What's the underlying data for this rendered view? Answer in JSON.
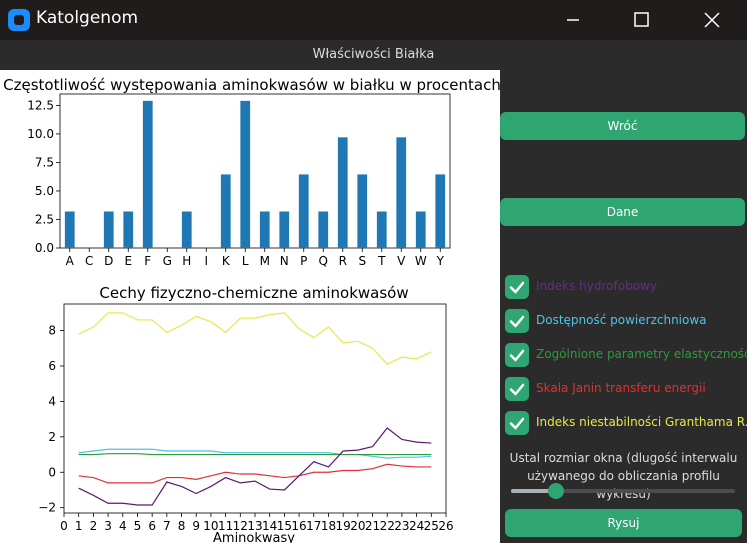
{
  "window": {
    "title": "Katolgenom"
  },
  "header": {
    "title": "Właściwości Białka"
  },
  "sidebar": {
    "back_label": "Wróć",
    "data_label": "Dane",
    "checkboxes": [
      {
        "label": "Indeks hydrofobowy",
        "color": "#6a2a8c",
        "checked": true
      },
      {
        "label": "Dostępność powierzchniowa",
        "color": "#4fc3e8",
        "checked": true
      },
      {
        "label": "Zogólnione parametry elastyczności",
        "color": "#2e9a3a",
        "checked": true
      },
      {
        "label": "Skala Janin transferu energii",
        "color": "#e03030",
        "checked": true
      },
      {
        "label": "Indeks niestabilności Granthama R.",
        "color": "#e6e84a",
        "checked": true
      }
    ],
    "slider": {
      "label": "Ustal rozmiar okna (dlugość interwalu używanego do obliczania profilu wykresu)",
      "value": 0.2
    },
    "draw_label": "Rysuj"
  },
  "chart_data": [
    {
      "type": "bar",
      "title": "Częstotliwość występowania aminokwasów w białku w procentach",
      "xlabel": "",
      "ylabel": "",
      "categories": [
        "A",
        "C",
        "D",
        "E",
        "F",
        "G",
        "H",
        "I",
        "K",
        "L",
        "M",
        "N",
        "P",
        "Q",
        "R",
        "S",
        "T",
        "V",
        "W",
        "Y"
      ],
      "values": [
        3.2,
        0,
        3.2,
        3.2,
        12.9,
        0,
        3.2,
        0,
        6.45,
        12.9,
        3.2,
        3.2,
        6.45,
        3.2,
        9.7,
        6.45,
        3.2,
        9.7,
        3.2,
        6.45
      ],
      "yticks": [
        "0.0",
        "2.5",
        "5.0",
        "7.5",
        "10.0",
        "12.5"
      ],
      "ylim": [
        0,
        13.5
      ],
      "color": "#1f77b4"
    },
    {
      "type": "line",
      "title": "Cechy fizyczno-chemiczne aminokwasów",
      "xlabel": "Aminokwasy",
      "ylabel": "",
      "xlim": [
        0,
        26
      ],
      "ylim": [
        -2.3,
        9.5
      ],
      "xticks": [
        "0",
        "1",
        "2",
        "3",
        "4",
        "5",
        "6",
        "7",
        "8",
        "9",
        "10",
        "11",
        "12",
        "13",
        "14",
        "15",
        "16",
        "17",
        "18",
        "19",
        "20",
        "21",
        "22",
        "23",
        "24",
        "25",
        "26"
      ],
      "yticks": [
        "−2",
        "0",
        "2",
        "4",
        "6",
        "8"
      ],
      "x": [
        1,
        2,
        3,
        4,
        5,
        6,
        7,
        8,
        9,
        10,
        11,
        12,
        13,
        14,
        15,
        16,
        17,
        18,
        19,
        20,
        21,
        22,
        23,
        24,
        25
      ],
      "series": [
        {
          "color": "#e6e84a",
          "values": [
            7.8,
            8.2,
            9.0,
            9.0,
            8.6,
            8.6,
            7.9,
            8.3,
            8.8,
            8.5,
            7.9,
            8.7,
            8.7,
            8.9,
            9.0,
            8.1,
            7.6,
            8.2,
            7.3,
            7.4,
            7.0,
            6.1,
            6.5,
            6.4,
            6.8
          ]
        },
        {
          "color": "#4fc3e8",
          "values": [
            1.1,
            1.2,
            1.3,
            1.3,
            1.3,
            1.3,
            1.2,
            1.2,
            1.2,
            1.2,
            1.1,
            1.1,
            1.1,
            1.1,
            1.1,
            1.1,
            1.1,
            1.1,
            1.0,
            1.0,
            0.9,
            0.8,
            0.85,
            0.85,
            0.9
          ]
        },
        {
          "color": "#2e9a3a",
          "values": [
            1.0,
            1.0,
            1.05,
            1.05,
            1.05,
            1.0,
            1.0,
            1.0,
            1.0,
            1.0,
            1.0,
            1.0,
            1.0,
            1.0,
            1.0,
            1.0,
            1.0,
            1.0,
            1.0,
            1.0,
            1.0,
            1.0,
            1.0,
            1.0,
            1.0
          ]
        },
        {
          "color": "#e03030",
          "values": [
            -0.2,
            -0.3,
            -0.6,
            -0.6,
            -0.6,
            -0.6,
            -0.3,
            -0.3,
            -0.4,
            -0.2,
            0.0,
            -0.1,
            -0.1,
            -0.2,
            -0.3,
            -0.2,
            0.0,
            0.0,
            0.1,
            0.1,
            0.2,
            0.45,
            0.35,
            0.3,
            0.3
          ]
        },
        {
          "color": "#5a1a6e",
          "values": [
            -0.9,
            -1.3,
            -1.75,
            -1.75,
            -1.85,
            -1.85,
            -0.55,
            -0.8,
            -1.2,
            -0.8,
            -0.3,
            -0.6,
            -0.5,
            -0.95,
            -1.0,
            -0.2,
            0.6,
            0.3,
            1.2,
            1.25,
            1.45,
            2.5,
            1.85,
            1.7,
            1.65
          ]
        }
      ]
    }
  ]
}
